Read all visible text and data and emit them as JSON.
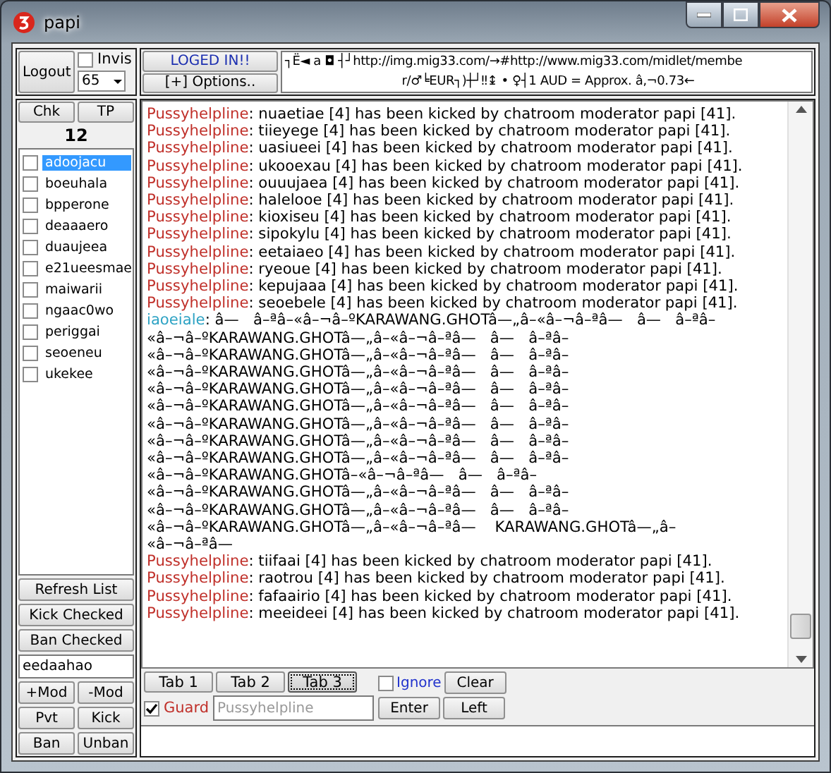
{
  "window": {
    "title": "papi"
  },
  "top": {
    "logout": "Logout",
    "invisible": {
      "label": "Invis",
      "checked": false
    },
    "count_select": "65",
    "status_button": "LOGED IN!!",
    "options_button": "[+] Options..",
    "banner_lines": [
      "┐Ë◄  a  ◘  ┤┘http://img.mig33.com/→#http://www.mig33.com/midlet/membe",
      "r/♂╘EUR┐)┼┘‼↨  •  ♀┤1 AUD = Approx. â‚¬0.73←"
    ]
  },
  "sidebar": {
    "buttons": [
      "Chk",
      "TP"
    ],
    "user_count": "12",
    "users": [
      {
        "name": "adoojacu",
        "checked": false,
        "selected": true
      },
      {
        "name": "boeuhala",
        "checked": false,
        "selected": false
      },
      {
        "name": "bpperone",
        "checked": false,
        "selected": false
      },
      {
        "name": "deaaaero",
        "checked": false,
        "selected": false
      },
      {
        "name": "duaujeea",
        "checked": false,
        "selected": false
      },
      {
        "name": "e21ueesmae",
        "checked": false,
        "selected": false
      },
      {
        "name": "maiwarii",
        "checked": false,
        "selected": false
      },
      {
        "name": "ngaac0wo",
        "checked": false,
        "selected": false
      },
      {
        "name": "periggai",
        "checked": false,
        "selected": false
      },
      {
        "name": "seoeneu",
        "checked": false,
        "selected": false
      },
      {
        "name": "ukekee",
        "checked": false,
        "selected": false
      }
    ],
    "actions": [
      "Refresh List",
      "Kick Checked",
      "Ban Checked"
    ],
    "name_field": "eedaahao",
    "pair_buttons": [
      [
        "+Mod",
        "-Mod"
      ],
      [
        "Pvt",
        "Kick"
      ],
      [
        "Ban",
        "Unban"
      ]
    ]
  },
  "chat": {
    "messages": [
      {
        "user": "Pussyhelpline",
        "color": "#c0302a",
        "text": ": nuaetiae [4] has been kicked by chatroom moderator papi [41]."
      },
      {
        "user": "Pussyhelpline",
        "color": "#c0302a",
        "text": ": tiieyege [4] has been kicked by chatroom moderator papi [41]."
      },
      {
        "user": "Pussyhelpline",
        "color": "#c0302a",
        "text": ": uasiueei [4] has been kicked by chatroom moderator papi [41]."
      },
      {
        "user": "Pussyhelpline",
        "color": "#c0302a",
        "text": ": ukooexau [4] has been kicked by chatroom moderator papi [41]."
      },
      {
        "user": "Pussyhelpline",
        "color": "#c0302a",
        "text": ": ouuujaea [4] has been kicked by chatroom moderator papi [41]."
      },
      {
        "user": "Pussyhelpline",
        "color": "#c0302a",
        "text": ": halelooe [4] has been kicked by chatroom moderator papi [41]."
      },
      {
        "user": "Pussyhelpline",
        "color": "#c0302a",
        "text": ": kioxiseu [4] has been kicked by chatroom moderator papi [41]."
      },
      {
        "user": "Pussyhelpline",
        "color": "#c0302a",
        "text": ": sipokylu [4] has been kicked by chatroom moderator papi [41]."
      },
      {
        "user": "Pussyhelpline",
        "color": "#c0302a",
        "text": ": eetaiaeo [4] has been kicked by chatroom moderator papi [41]."
      },
      {
        "user": "Pussyhelpline",
        "color": "#c0302a",
        "text": ": ryeoue [4] has been kicked by chatroom moderator papi [41]."
      },
      {
        "user": "Pussyhelpline",
        "color": "#c0302a",
        "text": ": kepujaaa [4] has been kicked by chatroom moderator papi [41]."
      },
      {
        "user": "Pussyhelpline",
        "color": "#c0302a",
        "text": ": seoebele [4] has been kicked by chatroom moderator papi [41]."
      },
      {
        "user": "iaoeiale",
        "color": "#2ea3c4",
        "text": ": â—   â–ªâ–«â–¬â–ºKARAWANG.GHOTâ—„â–«â–¬â–ªâ—   â—   â–ªâ–",
        "continuation": [
          "«â–¬â–ºKARAWANG.GHOTâ—„â–«â–¬â–ªâ—   â—   â–ªâ–",
          "«â–¬â–ºKARAWANG.GHOTâ—„â–«â–¬â–ªâ—   â—   â–ªâ–",
          "«â–¬â–ºKARAWANG.GHOTâ—„â–«â–¬â–ªâ—   â—   â–ªâ–",
          "«â–¬â–ºKARAWANG.GHOTâ—„â–«â–¬â–ªâ—   â—   â–ªâ–",
          "«â–¬â–ºKARAWANG.GHOTâ—„â–«â–¬â–ªâ—   â—   â–ªâ–",
          "«â–¬â–ºKARAWANG.GHOTâ—„â–«â–¬â–ªâ—   â—   â–ªâ–",
          "«â–¬â–ºKARAWANG.GHOTâ—„â–«â–¬â–ªâ—   â—   â–ªâ–",
          "«â–¬â–ºKARAWANG.GHOTâ—„â–«â–¬â–ªâ—   â—   â–ªâ–",
          "«â–¬â–ºKARAWANG.GHOTâ–«â–¬â–ªâ—   â—   â–ªâ–",
          "«â–¬â–ºKARAWANG.GHOTâ—„â–«â–¬â–ªâ—   â—   â–ªâ–",
          "«â–¬â–ºKARAWANG.GHOTâ—„â–«â–¬â–ªâ—   â—   â–ªâ–",
          "«â–¬â–ºKARAWANG.GHOTâ—„â–«â–¬â–ªâ—    KARAWANG.GHOTâ—„â–",
          "«â–¬â–ªâ—"
        ]
      },
      {
        "user": "Pussyhelpline",
        "color": "#c0302a",
        "text": ": tiifaai [4] has been kicked by chatroom moderator papi [41]."
      },
      {
        "user": "Pussyhelpline",
        "color": "#c0302a",
        "text": ": raotrou [4] has been kicked by chatroom moderator papi [41]."
      },
      {
        "user": "Pussyhelpline",
        "color": "#c0302a",
        "text": ": fafaairio [4] has been kicked by chatroom moderator papi [41]."
      },
      {
        "user": "Pussyhelpline",
        "color": "#c0302a",
        "text": ": meeideei [4] has been kicked by chatroom moderator papi [41]."
      }
    ]
  },
  "tabs": [
    {
      "label": "Tab 1",
      "selected": false
    },
    {
      "label": "Tab 2",
      "selected": false
    },
    {
      "label": "Tab 3",
      "selected": true
    }
  ],
  "ignore": {
    "label": "Ignore",
    "checked": false
  },
  "guard": {
    "label": "Guard",
    "checked": true
  },
  "guard_target": {
    "placeholder": "Pussyhelpline"
  },
  "buttons": [
    [
      "Clear"
    ],
    [
      "Enter",
      "Left"
    ]
  ]
}
